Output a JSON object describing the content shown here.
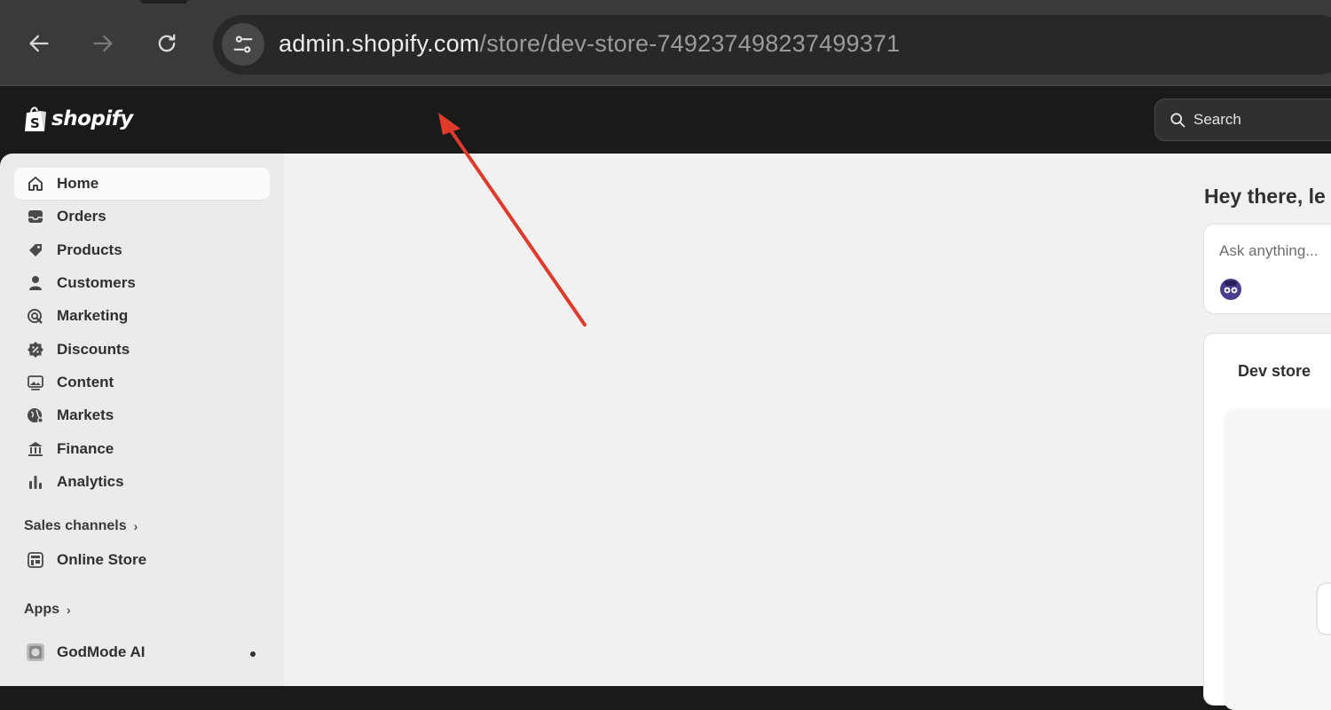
{
  "browser": {
    "url_host": "admin.shopify.com",
    "url_path": "/store/dev-store-749237498237499371"
  },
  "header": {
    "logo_text": "shopify",
    "search_placeholder": "Search"
  },
  "sidebar": {
    "items": [
      {
        "label": "Home",
        "icon": "home-icon",
        "active": true
      },
      {
        "label": "Orders",
        "icon": "inbox-icon"
      },
      {
        "label": "Products",
        "icon": "tag-icon"
      },
      {
        "label": "Customers",
        "icon": "person-icon"
      },
      {
        "label": "Marketing",
        "icon": "target-icon"
      },
      {
        "label": "Discounts",
        "icon": "discount-badge-icon"
      },
      {
        "label": "Content",
        "icon": "image-icon"
      },
      {
        "label": "Markets",
        "icon": "globe-icon"
      },
      {
        "label": "Finance",
        "icon": "bank-icon"
      },
      {
        "label": "Analytics",
        "icon": "bar-chart-icon"
      }
    ],
    "sales_channels_label": "Sales channels",
    "online_store_label": "Online Store",
    "apps_label": "Apps",
    "godmode_label": "GodMode AI"
  },
  "main": {
    "greeting": "Hey there, le",
    "ask_placeholder": "Ask anything...",
    "store_card_title": "Dev store"
  },
  "colors": {
    "annotation_arrow": "#e03a2a",
    "top_bar": "#1a1a1a",
    "sidebar_bg": "#ebebeb",
    "main_bg": "#f1f1f1"
  }
}
